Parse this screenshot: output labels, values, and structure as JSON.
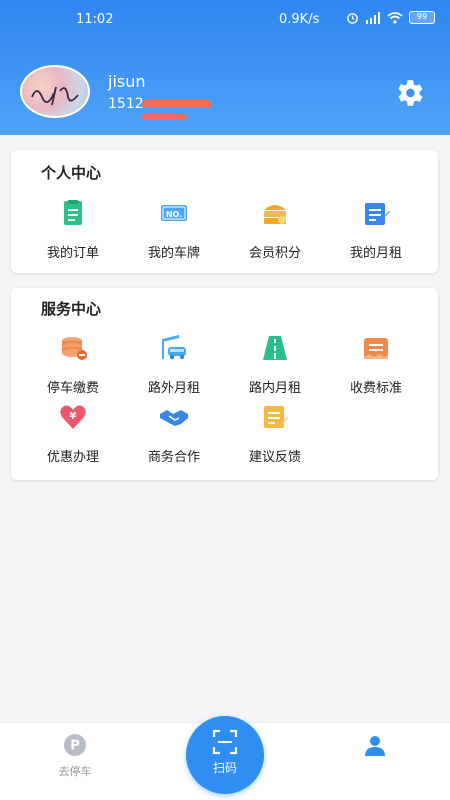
{
  "status_bar": {
    "time": "11:02",
    "network_speed": "0.9K/s",
    "battery": "99"
  },
  "profile": {
    "username": "jisun",
    "phone": "1512"
  },
  "personal_center": {
    "title": "个人中心",
    "items": [
      {
        "label": "我的订单",
        "icon": "order-list-icon",
        "color": "#2bbf8a"
      },
      {
        "label": "我的车牌",
        "icon": "license-plate-icon",
        "color": "#4aa8f0"
      },
      {
        "label": "会员积分",
        "icon": "member-points-icon",
        "color": "#f5a623"
      },
      {
        "label": "我的月租",
        "icon": "monthly-rent-icon",
        "color": "#3a86e8"
      }
    ]
  },
  "service_center": {
    "title": "服务中心",
    "items": [
      {
        "label": "停车缴费",
        "icon": "parking-payment-icon",
        "color": "#f08a4b"
      },
      {
        "label": "路外月租",
        "icon": "off-road-rent-icon",
        "color": "#4aa8f0"
      },
      {
        "label": "路内月租",
        "icon": "on-road-rent-icon",
        "color": "#2bbf8a"
      },
      {
        "label": "收费标准",
        "icon": "fee-standard-icon",
        "color": "#f08a4b"
      },
      {
        "label": "优惠办理",
        "icon": "discount-icon",
        "color": "#f0566a"
      },
      {
        "label": "商务合作",
        "icon": "handshake-icon",
        "color": "#3a86e8"
      },
      {
        "label": "建议反馈",
        "icon": "feedback-icon",
        "color": "#f5b942"
      }
    ]
  },
  "tabbar": {
    "park_label": "去停车",
    "scan_label": "扫码"
  },
  "colors": {
    "header": "#2f86f0",
    "accent": "#2f8ef2"
  }
}
